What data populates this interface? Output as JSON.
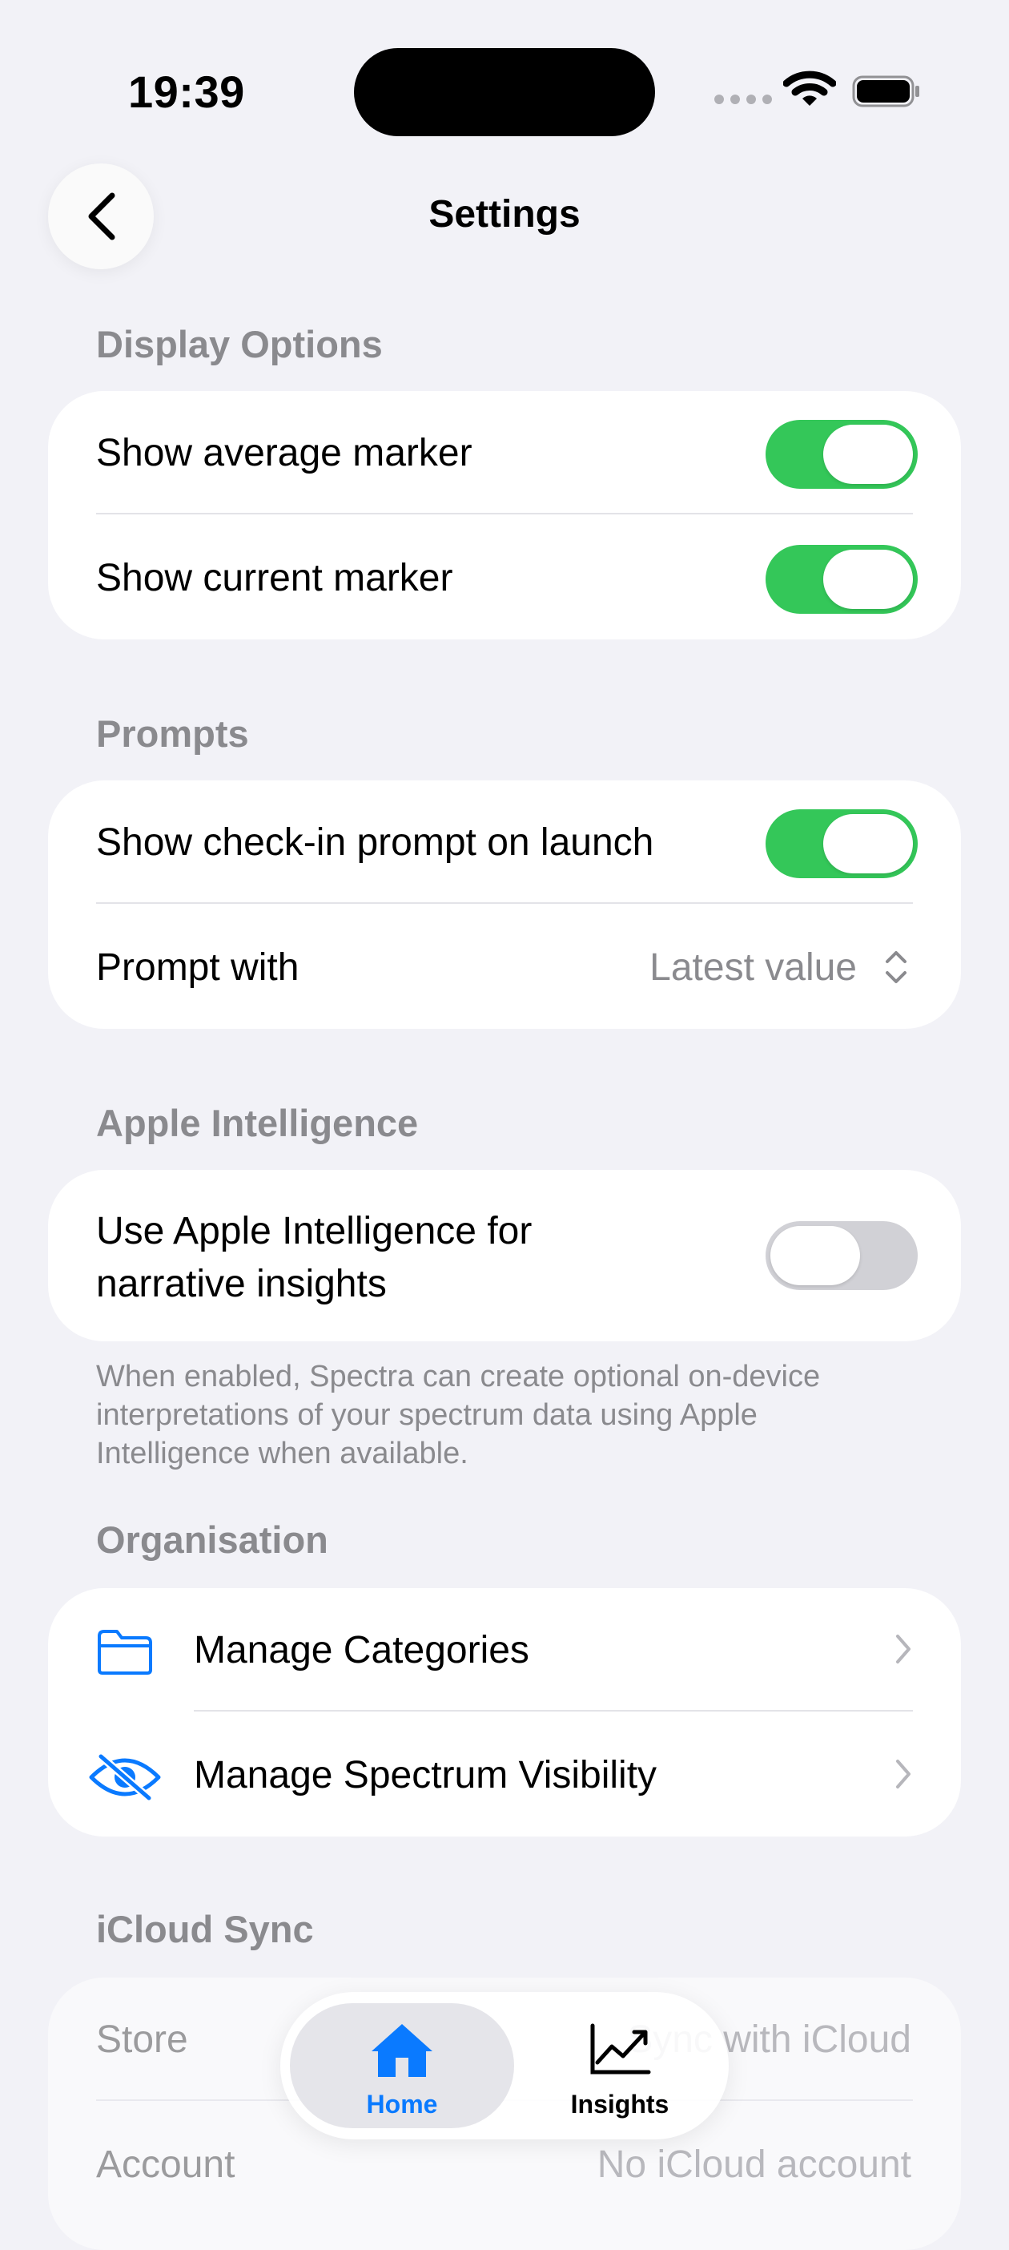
{
  "status_bar": {
    "time": "19:39",
    "icons": [
      "signal-dots-icon",
      "wifi-icon",
      "battery-icon"
    ]
  },
  "nav": {
    "title": "Settings",
    "back_icon": "chevron-left-icon"
  },
  "sections": {
    "display": {
      "header": "Display Options",
      "rows": [
        {
          "label": "Show average marker",
          "on": true
        },
        {
          "label": "Show current marker",
          "on": true
        }
      ]
    },
    "prompts": {
      "header": "Prompts",
      "check_in": {
        "label": "Show check-in prompt on launch",
        "on": true
      },
      "prompt_with": {
        "label": "Prompt with",
        "value": "Latest value"
      }
    },
    "ai": {
      "header": "Apple Intelligence",
      "label_line1": "Use Apple Intelligence for",
      "label_line2": "narrative insights",
      "on": false,
      "footnote": "When enabled, Spectra can create optional on-device interpretations of your spectrum data using Apple Intelligence when available."
    },
    "organisation": {
      "header": "Organisation",
      "items": [
        {
          "label": "Manage Categories",
          "icon": "folder-icon"
        },
        {
          "label": "Manage Spectrum Visibility",
          "icon": "eye-slash-icon"
        }
      ]
    },
    "icloud": {
      "header": "iCloud Sync",
      "store_label": "Store",
      "store_value": "Sync with iCloud",
      "account_label": "Account",
      "account_value": "No iCloud account"
    }
  },
  "tabbar": {
    "tabs": [
      {
        "label": "Home",
        "icon": "house-icon",
        "selected": true
      },
      {
        "label": "Insights",
        "icon": "chart-line-icon",
        "selected": false
      }
    ]
  },
  "colors": {
    "accent": "#0a7aff",
    "toggle_on": "#34c759",
    "toggle_off": "#d1d1d6",
    "background": "#f2f2f7"
  }
}
